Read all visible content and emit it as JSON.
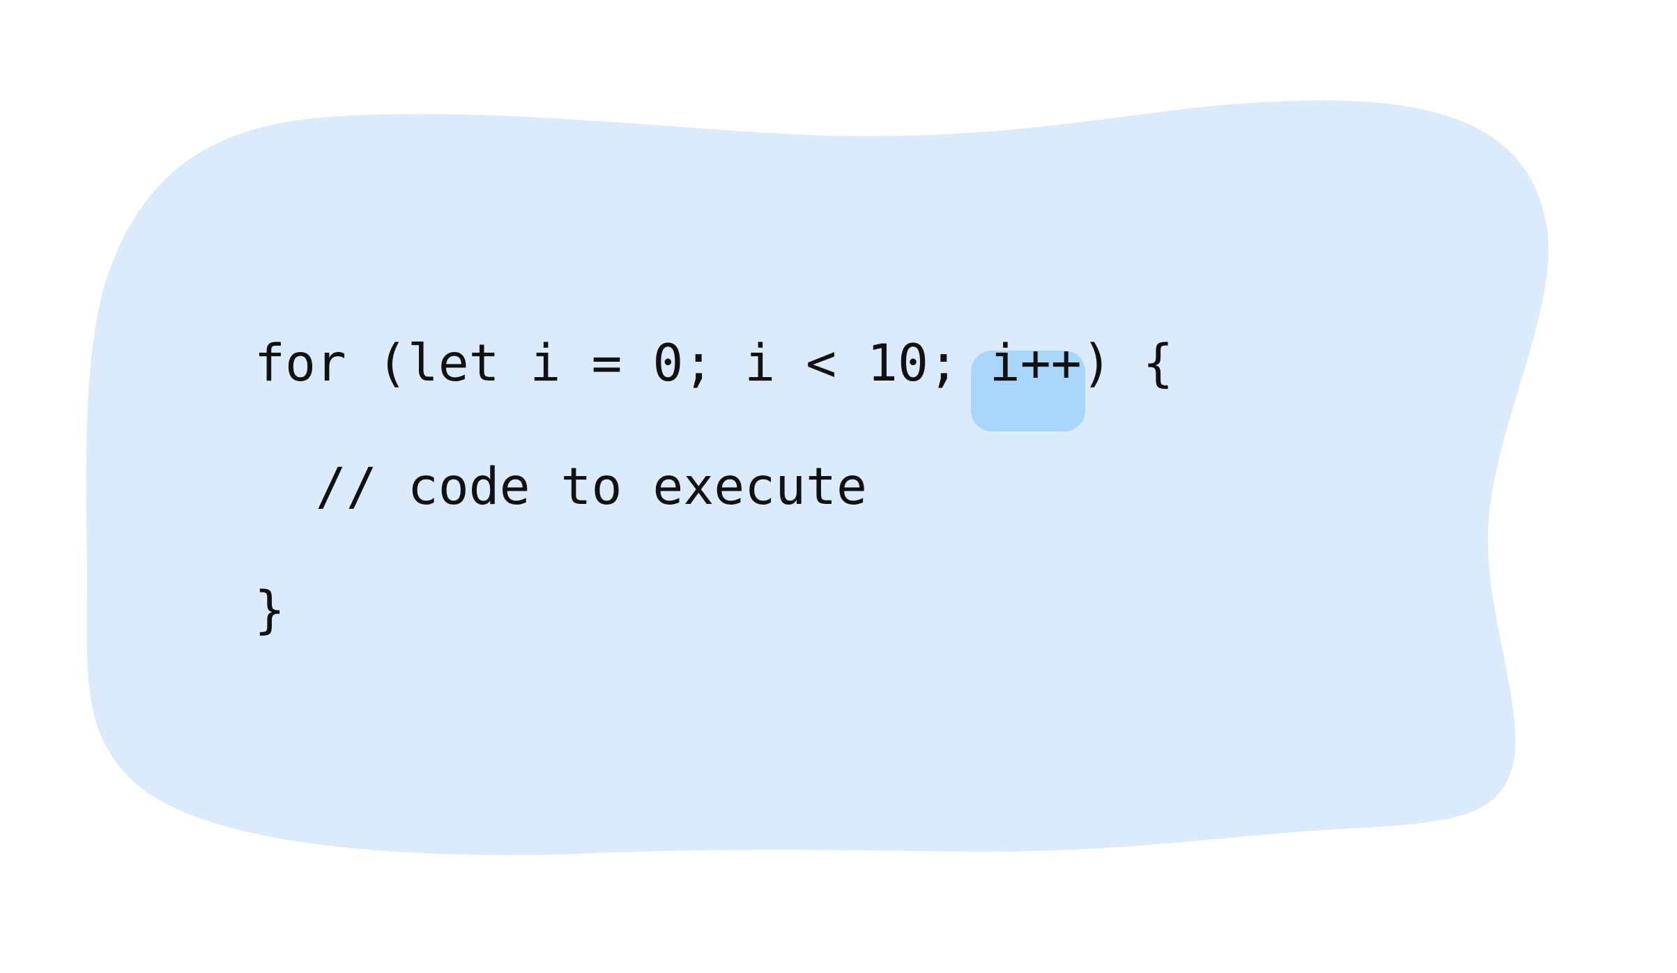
{
  "colors": {
    "blob": "#dcebfb",
    "highlight": "#a8d5fa",
    "text": "#111111"
  },
  "code": {
    "lines": [
      {
        "before": "for (let i = 0; i < 10; ",
        "highlight": "i++",
        "after": ") {"
      },
      {
        "text": "  // code to execute"
      },
      {
        "text": "}"
      }
    ]
  }
}
